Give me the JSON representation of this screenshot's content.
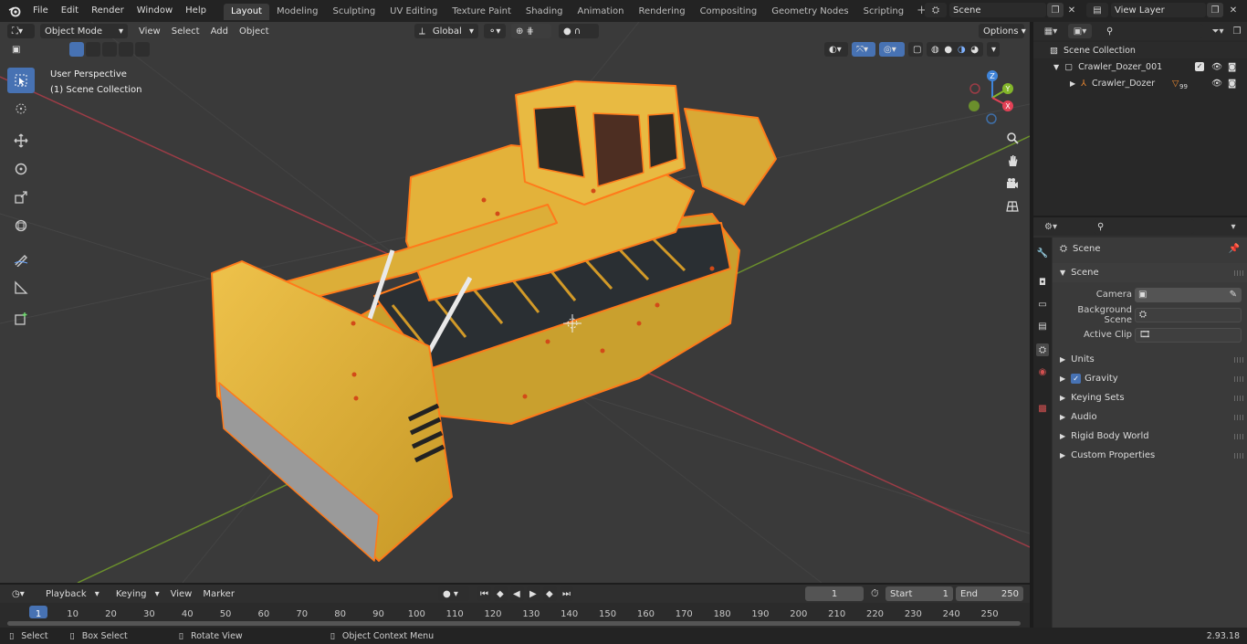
{
  "menu": [
    "File",
    "Edit",
    "Render",
    "Window",
    "Help"
  ],
  "workspaces": [
    "Layout",
    "Modeling",
    "Sculpting",
    "UV Editing",
    "Texture Paint",
    "Shading",
    "Animation",
    "Rendering",
    "Compositing",
    "Geometry Nodes",
    "Scripting"
  ],
  "active_workspace": "Layout",
  "scene_name": "Scene",
  "view_layer": "View Layer",
  "viewport": {
    "mode": "Object Mode",
    "menus": [
      "View",
      "Select",
      "Add",
      "Object"
    ],
    "transform_orientation": "Global",
    "options_label": "Options",
    "view_name": "User Perspective",
    "collection_info": "(1) Scene Collection",
    "gizmo_axes": {
      "x": "X",
      "y": "Y",
      "z": "Z"
    }
  },
  "outliner": {
    "search_placeholder": "",
    "rows": [
      {
        "label": "Scene Collection"
      },
      {
        "label": "Crawler_Dozer_001"
      },
      {
        "label": "Crawler_Dozer",
        "badge": "99"
      }
    ]
  },
  "properties": {
    "header": "Scene",
    "panel_title": "Scene",
    "fields": [
      {
        "label": "Camera"
      },
      {
        "label": "Background Scene"
      },
      {
        "label": "Active Clip"
      }
    ],
    "sections": [
      "Units",
      "Gravity",
      "Keying Sets",
      "Audio",
      "Rigid Body World",
      "Custom Properties"
    ]
  },
  "timeline": {
    "menus": [
      "Playback",
      "Keying",
      "View",
      "Marker"
    ],
    "current_frame": "1",
    "start_label": "Start",
    "start": "1",
    "end_label": "End",
    "end": "250",
    "ticks": [
      "1",
      "10",
      "20",
      "30",
      "40",
      "50",
      "60",
      "70",
      "80",
      "90",
      "100",
      "110",
      "120",
      "130",
      "140",
      "150",
      "160",
      "170",
      "180",
      "190",
      "200",
      "210",
      "220",
      "230",
      "240",
      "250"
    ]
  },
  "status_bar": {
    "items": [
      "Select",
      "Box Select",
      "Rotate View",
      "Object Context Menu"
    ],
    "version": "2.93.18"
  },
  "colors": {
    "accent": "#4772b3",
    "selection_outline": "#ff7a1a",
    "dozer_yellow": "#e8b431",
    "axis_x": "#e34156",
    "axis_y": "#83b62a",
    "axis_z": "#3f84d9"
  }
}
